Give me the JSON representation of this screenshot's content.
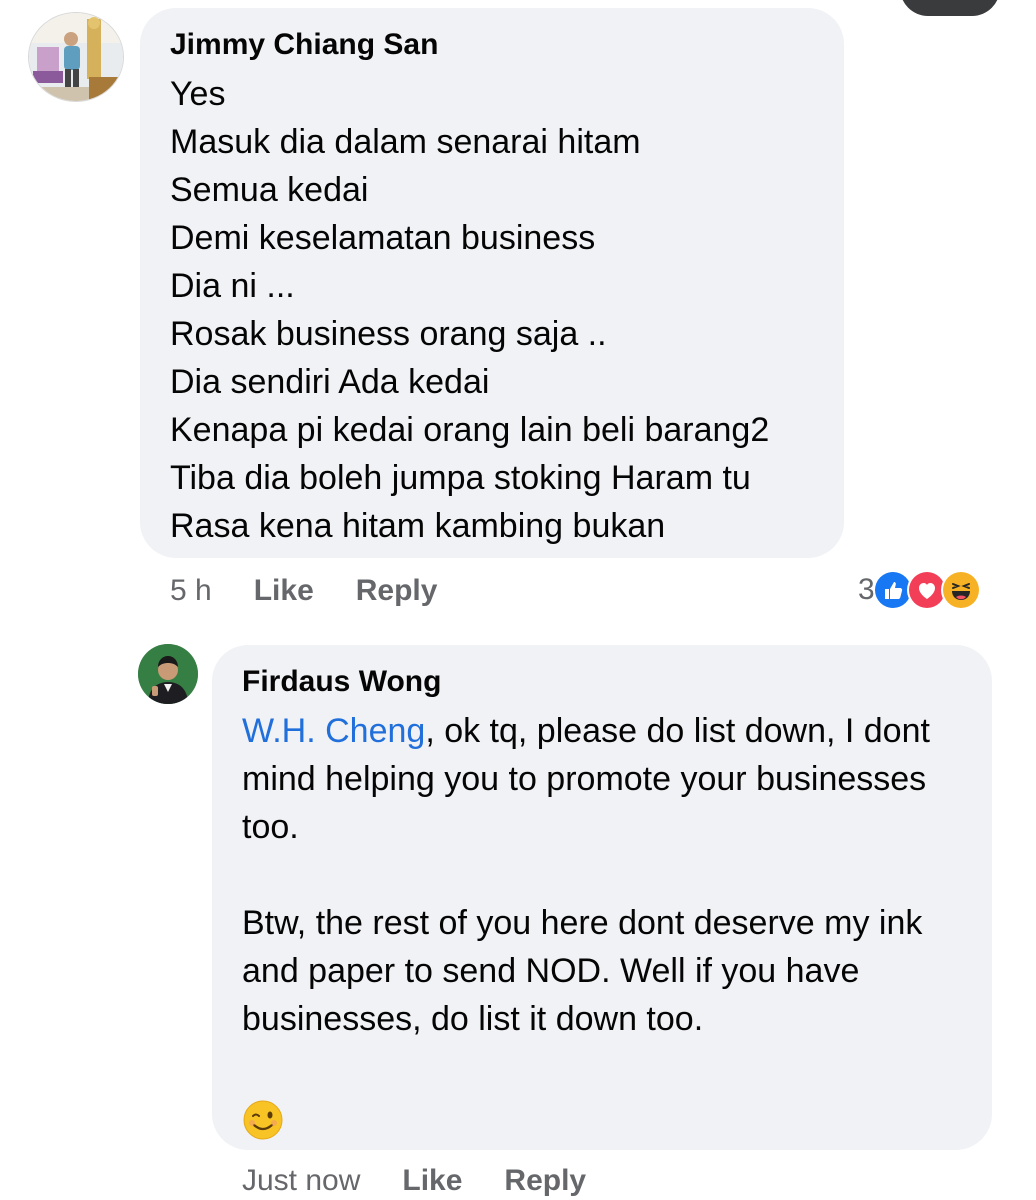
{
  "comments": [
    {
      "author": "Jimmy Chiang San",
      "lines": [
        "Yes",
        "Masuk dia dalam senarai hitam",
        "Semua kedai",
        "Demi keselamatan business",
        "Dia ni ...",
        "Rosak business orang saja ..",
        "Dia sendiri Ada kedai",
        "Kenapa pi kedai orang lain beli barang2",
        "Tiba dia boleh jumpa stoking Haram tu",
        "Rasa kena hitam kambing bukan"
      ],
      "time": "5 h",
      "like_label": "Like",
      "reply_label": "Reply",
      "reaction_count": "3",
      "reactions": [
        "like-icon",
        "love-icon",
        "haha-icon"
      ]
    },
    {
      "author": "Firdaus Wong",
      "mention": "W.H. Cheng",
      "para1_rest": ", ok tq, please do list down, I dont mind helping you to promote your businesses too.",
      "para2": "Btw, the rest of you here dont deserve my ink and paper to send NOD. Well if you have businesses, do list it down too.",
      "emoji": "winking-face-icon",
      "time": "Just now",
      "like_label": "Like",
      "reply_label": "Reply"
    }
  ],
  "colors": {
    "bubble": "#f0f2f5",
    "mention": "#216fdb",
    "meta": "#65676b",
    "like_blue": "#1877f2",
    "love_red": "#f33e58",
    "haha_yellow": "#f7b125"
  }
}
